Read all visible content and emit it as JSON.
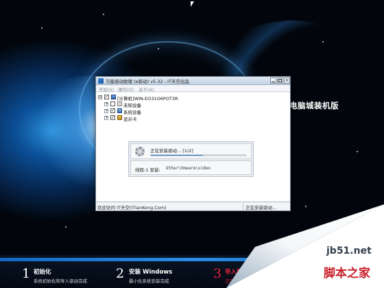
{
  "desktop": {
    "brand_text": "电脑城装机版"
  },
  "window": {
    "title": "万能驱动助理 (e驱动) v5.32 - IT天空出品",
    "buttons": {
      "minimize": "_",
      "maximize": "□",
      "close": "×"
    },
    "menu": [
      {
        "label": "开始(S)"
      },
      {
        "label": "操作(O)"
      },
      {
        "label": "关于(A)"
      }
    ],
    "tree": {
      "root": {
        "label": "[计算机]WIN-EO31O6POT3R",
        "expander": "⊟",
        "checked": "✓"
      },
      "children": [
        {
          "label": "未知设备",
          "expander": "+",
          "checked": ""
        },
        {
          "label": "系统设备",
          "expander": "+",
          "checked": "✓"
        },
        {
          "label": "显示卡",
          "expander": "+",
          "checked": "✓"
        }
      ]
    },
    "progress": {
      "label": "正在安装驱动... [1/2]",
      "fraction": 0.55
    },
    "thread": {
      "label": "线程-1 安装:",
      "path": "Other\\Vmware\\video"
    },
    "status": {
      "left": "欢迎访问 IT天空(iTianKong.Com)",
      "right": "正在安装驱动..."
    }
  },
  "steps": [
    {
      "num": "1",
      "title": "初始化",
      "sub": "系统初始化和导入驱动完成"
    },
    {
      "num": "2",
      "title": "安装 Windows",
      "sub": "最小化系统安装完成"
    },
    {
      "num": "3",
      "title": "导入驱",
      "sub": "正在导"
    }
  ],
  "watermark": {
    "site": "jb51.net",
    "name": "脚本之家"
  },
  "colors": {
    "accent": "#2f86d8",
    "step_active": "#e0243a",
    "watermark_red": "#c8202a"
  }
}
